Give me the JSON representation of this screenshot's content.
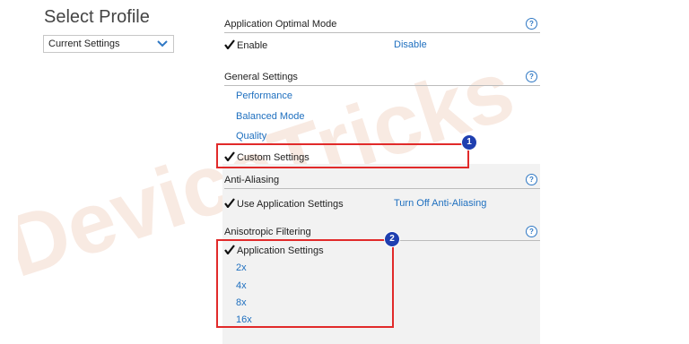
{
  "watermark": "DeviceTricks",
  "profile": {
    "title": "Select Profile",
    "selected": "Current Settings"
  },
  "sections": {
    "app_optimal": {
      "title": "Application Optimal Mode",
      "selected": "Enable",
      "other": "Disable"
    },
    "general": {
      "title": "General Settings",
      "options": [
        "Performance",
        "Balanced Mode",
        "Quality"
      ],
      "selected": "Custom Settings"
    },
    "anti_aliasing": {
      "title": "Anti-Aliasing",
      "selected": "Use Application Settings",
      "other": "Turn Off Anti-Aliasing"
    },
    "anisotropic": {
      "title": "Anisotropic Filtering",
      "selected": "Application Settings",
      "options": [
        "2x",
        "4x",
        "8x",
        "16x"
      ]
    }
  },
  "help_glyph": "?",
  "annotations": {
    "badge1": "1",
    "badge2": "2"
  },
  "colors": {
    "link": "#1e6fbf",
    "highlight": "#e12a2a",
    "badge": "#1f3fb0",
    "panel": "#f2f2f2"
  }
}
